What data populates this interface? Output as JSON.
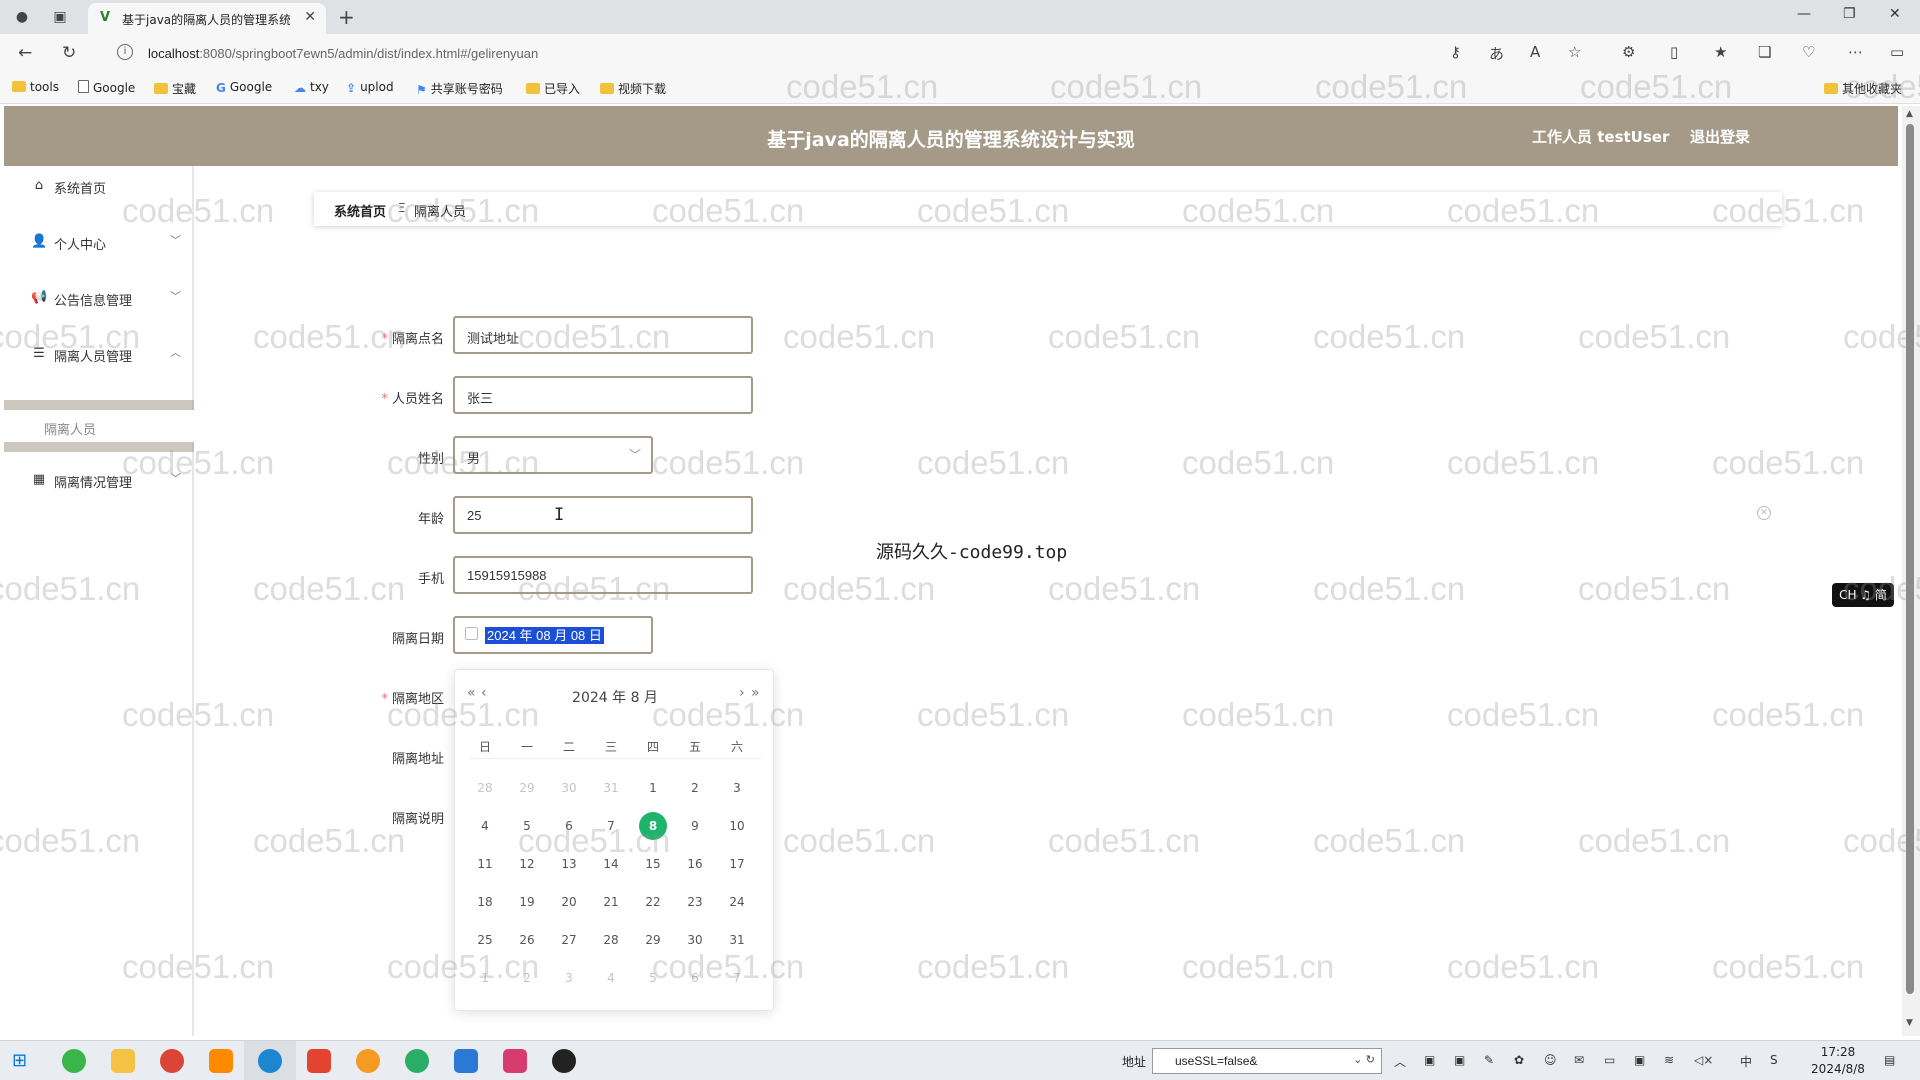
{
  "browser": {
    "tab_title": "基于java的隔离人员的管理系统设",
    "url_host": "localhost",
    "url_rest": ":8080/springboot7ewn5/admin/dist/index.html#/gelirenyuan",
    "bookmarks": [
      "tools",
      "Google",
      "宝藏",
      "Google",
      "txy",
      "uplod",
      "共享账号密码",
      "已导入",
      "视频下载",
      "其他收藏夹"
    ]
  },
  "header": {
    "title": "基于java的隔离人员的管理系统设计与实现",
    "user_label": "工作人员 testUser",
    "logout": "退出登录"
  },
  "sidebar": {
    "items": [
      {
        "label": "系统首页",
        "icon": "home-icon"
      },
      {
        "label": "个人中心",
        "icon": "user-icon"
      },
      {
        "label": "公告信息管理",
        "icon": "megaphone-icon"
      },
      {
        "label": "隔离人员管理",
        "icon": "list-icon"
      },
      {
        "label": "隔离情况管理",
        "icon": "grid-icon"
      }
    ],
    "sub_item": "隔离人员"
  },
  "breadcrumb": {
    "home": "系统首页",
    "current": "隔离人员"
  },
  "form": {
    "site_name": {
      "label": "隔离点名",
      "value": "测试地址"
    },
    "person_name": {
      "label": "人员姓名",
      "value": "张三"
    },
    "gender": {
      "label": "性别",
      "value": "男"
    },
    "age": {
      "label": "年龄",
      "value": "25"
    },
    "phone": {
      "label": "手机",
      "value": "15915915988"
    },
    "date": {
      "label": "隔离日期",
      "value": "2024 年 08 月 08 日"
    },
    "region": {
      "label": "隔离地区"
    },
    "address": {
      "label": "隔离地址"
    },
    "note": {
      "label": "隔离说明"
    }
  },
  "datepicker": {
    "title": "2024 年   8 月",
    "weekdays": [
      "日",
      "一",
      "二",
      "三",
      "四",
      "五",
      "六"
    ],
    "weeks": [
      [
        "28",
        "29",
        "30",
        "31",
        "1",
        "2",
        "3"
      ],
      [
        "4",
        "5",
        "6",
        "7",
        "8",
        "9",
        "10"
      ],
      [
        "11",
        "12",
        "13",
        "14",
        "15",
        "16",
        "17"
      ],
      [
        "18",
        "19",
        "20",
        "21",
        "22",
        "23",
        "24"
      ],
      [
        "25",
        "26",
        "27",
        "28",
        "29",
        "30",
        "31"
      ],
      [
        "1",
        "2",
        "3",
        "4",
        "5",
        "6",
        "7"
      ]
    ],
    "selected_day": "8"
  },
  "overlay_text": "源码久久-code99.top",
  "watermark": "code51.cn",
  "ime": "CH ♫ 简",
  "taskbar": {
    "addr_label": "地址",
    "addr_value": "useSSL=false&",
    "time": "17:28",
    "date": "2024/8/8",
    "tray_lang": "中"
  }
}
